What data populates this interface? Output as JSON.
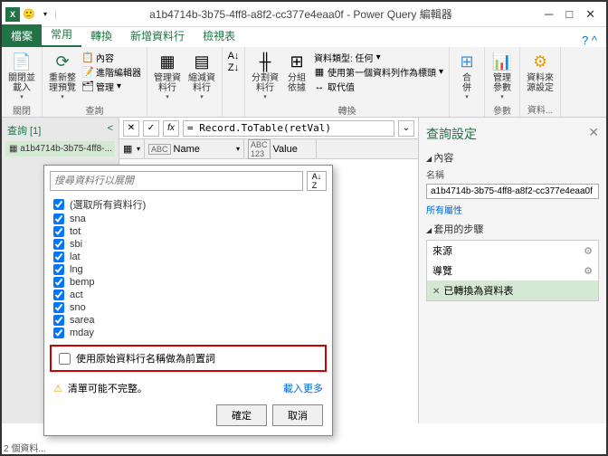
{
  "title": "a1b4714b-3b75-4ff8-a8f2-cc377e4eaa0f - Power Query 編輯器",
  "tabs": {
    "file": "檔案",
    "home": "常用",
    "transform": "轉換",
    "addcol": "新增資料行",
    "view": "檢視表"
  },
  "ribbon": {
    "closeload": "關閉並\n載入",
    "closegrp": "關閉",
    "refresh": "重新整\n理預覽",
    "props": "內容",
    "adv": "進階編輯器",
    "manage": "管理",
    "querygrp": "查詢",
    "managecols": "管理資\n料行",
    "reducerows": "縮減資\n料行",
    "split": "分割資\n料行",
    "groupby": "分組\n依據",
    "datatype": "資料類型: 任何",
    "firstrow": "使用第一個資料列作為標頭",
    "replace": "取代值",
    "transformgrp": "轉換",
    "combine": "合\n併",
    "params": "管理\n參數",
    "paramsgrp": "參數",
    "datasource": "資料來\n源設定",
    "dsgrp": "資料..."
  },
  "left": {
    "header": "查詢 [1]",
    "item": "a1b4714b-3b75-4ff8-..."
  },
  "fx": "= Record.ToTable(retVal)",
  "cols": {
    "name": "Name",
    "value": "Value"
  },
  "right": {
    "title": "查詢設定",
    "content": "內容",
    "namelabel": "名稱",
    "name": "a1b4714b-3b75-4ff8-a8f2-cc377e4eaa0f",
    "allprops": "所有屬性",
    "steps": "套用的步驟",
    "s1": "來源",
    "s2": "導覽",
    "s3": "已轉換為資料表"
  },
  "popup": {
    "search": "搜尋資料行以展開",
    "all": "(選取所有資料行)",
    "items": [
      "sna",
      "tot",
      "sbi",
      "lat",
      "lng",
      "bemp",
      "act",
      "sno",
      "sarea",
      "mday"
    ],
    "prefix": "使用原始資料行名稱做為前置詞",
    "warn": "清單可能不完整。",
    "more": "載入更多",
    "ok": "確定",
    "cancel": "取消"
  },
  "status": "2 個資料..."
}
